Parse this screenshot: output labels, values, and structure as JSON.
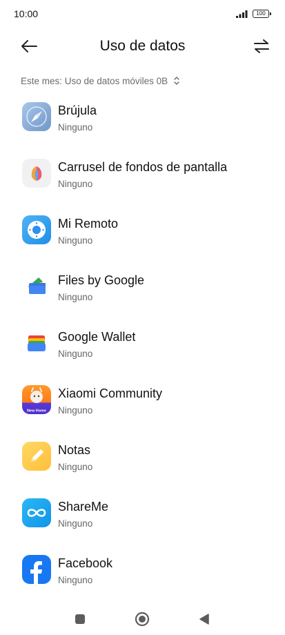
{
  "status_bar": {
    "time": "10:00",
    "battery": "100",
    "signal_icon": "signal-icon",
    "battery_icon": "battery-icon"
  },
  "header": {
    "title": "Uso de datos",
    "back_icon": "arrow-left-icon",
    "swap_icon": "swap-arrows-icon"
  },
  "filter": {
    "label": "Este mes: Uso de datos móviles 0B",
    "icon": "chevron-up-down-icon"
  },
  "apps": [
    {
      "name": "Brújula",
      "usage": "Ninguno",
      "icon": "compass-icon"
    },
    {
      "name": "Carrusel de fondos de pantalla",
      "usage": "Ninguno",
      "icon": "wallpaper-carousel-icon"
    },
    {
      "name": "Mi Remoto",
      "usage": "Ninguno",
      "icon": "remote-icon"
    },
    {
      "name": "Files by Google",
      "usage": "Ninguno",
      "icon": "files-icon"
    },
    {
      "name": "Google Wallet",
      "usage": "Ninguno",
      "icon": "wallet-icon"
    },
    {
      "name": "Xiaomi Community",
      "usage": "Ninguno",
      "icon": "community-icon",
      "icon_caption": "New Home"
    },
    {
      "name": "Notas",
      "usage": "Ninguno",
      "icon": "notes-icon"
    },
    {
      "name": "ShareMe",
      "usage": "Ninguno",
      "icon": "shareme-icon"
    },
    {
      "name": "Facebook",
      "usage": "Ninguno",
      "icon": "facebook-icon"
    }
  ],
  "nav_bar": {
    "recents_icon": "square-icon",
    "home_icon": "circle-icon",
    "back_icon": "triangle-back-icon"
  },
  "colors": {
    "facebook": "#1877F2",
    "shareme": "#1AA1F0",
    "notes": "#FFC94A",
    "remote": "#2D9CF0",
    "community": "#FF8A1E"
  }
}
